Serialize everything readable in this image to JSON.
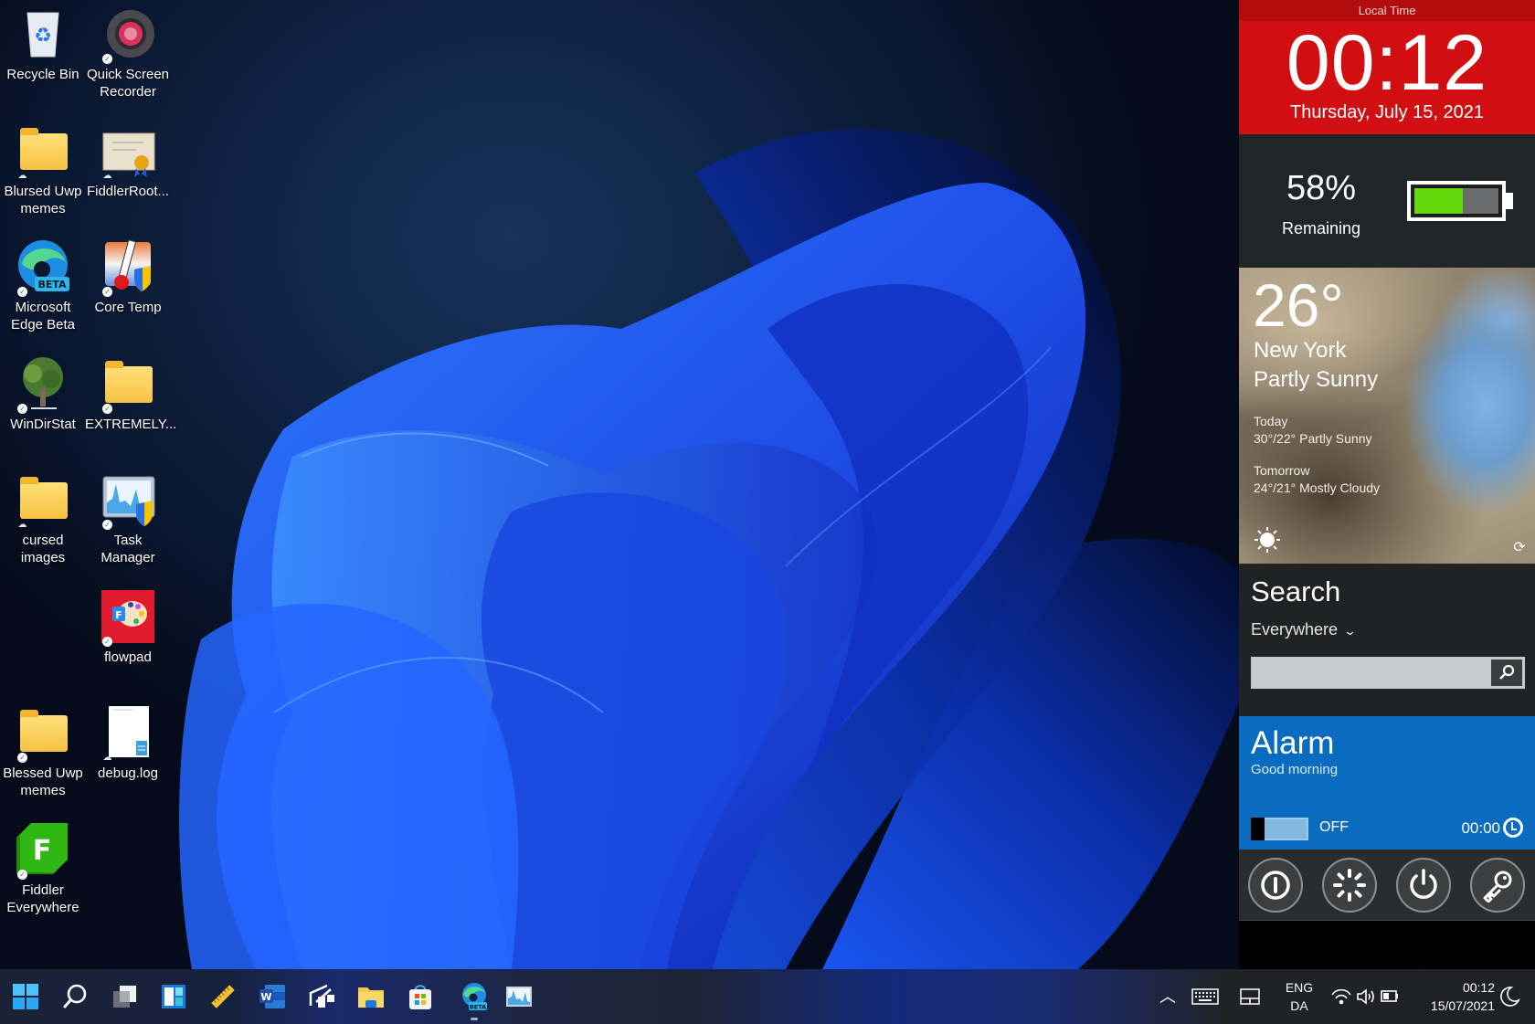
{
  "desktop": {
    "icons": [
      {
        "label": "Recycle Bin",
        "icon": "recycle-bin-icon",
        "status": ""
      },
      {
        "label": "Quick Screen Recorder",
        "icon": "screen-recorder-icon",
        "status": "synced"
      },
      {
        "label": "Blursed Uwp memes",
        "icon": "folder-icon",
        "status": "cloud"
      },
      {
        "label": "FiddlerRoot...",
        "icon": "certificate-icon",
        "status": "cloud"
      },
      {
        "label": "Microsoft Edge Beta",
        "icon": "edge-beta-icon",
        "status": "synced"
      },
      {
        "label": "Core Temp",
        "icon": "thermometer-icon",
        "status": "synced"
      },
      {
        "label": "WinDirStat",
        "icon": "tree-icon",
        "status": "synced"
      },
      {
        "label": "EXTREMELY...",
        "icon": "folder-icon",
        "status": "synced"
      },
      {
        "label": "cursed images",
        "icon": "folder-icon",
        "status": "cloud"
      },
      {
        "label": "Task Manager",
        "icon": "task-manager-icon",
        "status": "synced"
      },
      {
        "label": "flowpad",
        "icon": "flowpad-icon",
        "status": "synced"
      },
      {
        "label": "Blessed Uwp memes",
        "icon": "folder-icon",
        "status": "synced"
      },
      {
        "label": "debug.log",
        "icon": "text-file-icon",
        "status": "cloud"
      },
      {
        "label": "Fiddler Everywhere",
        "icon": "fiddler-icon",
        "status": "synced"
      }
    ]
  },
  "panel": {
    "clock": {
      "header": "Local Time",
      "time": "00:12",
      "date": "Thursday, July 15, 2021",
      "color": "#d10f12"
    },
    "battery": {
      "percent_label": "58%",
      "remaining_label": "Remaining",
      "level": 0.58,
      "fill_color": "#63d90b"
    },
    "weather": {
      "temperature": "26°",
      "city": "New York",
      "condition": "Partly Sunny",
      "forecast": [
        {
          "day": "Today",
          "detail": "30°/22° Partly Sunny"
        },
        {
          "day": "Tomorrow",
          "detail": "24°/21° Mostly Cloudy"
        }
      ]
    },
    "search": {
      "title": "Search",
      "scope": "Everywhere",
      "value": "",
      "placeholder": ""
    },
    "alarm": {
      "title": "Alarm",
      "message": "Good morning",
      "state": "OFF",
      "time": "00:00",
      "color": "#0a6cc0"
    },
    "power_buttons": [
      {
        "name": "shutdown",
        "icon": "shutdown-icon"
      },
      {
        "name": "restart",
        "icon": "restart-icon"
      },
      {
        "name": "power",
        "icon": "power-icon"
      },
      {
        "name": "lock",
        "icon": "key-icon"
      }
    ]
  },
  "taskbar": {
    "apps": [
      {
        "name": "start",
        "icon": "windows-start-icon"
      },
      {
        "name": "search",
        "icon": "search-icon"
      },
      {
        "name": "task-view",
        "icon": "task-view-icon"
      },
      {
        "name": "widgets",
        "icon": "widgets-icon"
      },
      {
        "name": "ruler",
        "icon": "ruler-icon"
      },
      {
        "name": "word",
        "icon": "word-icon"
      },
      {
        "name": "snipping",
        "icon": "snip-icon"
      },
      {
        "name": "file-explorer",
        "icon": "file-explorer-icon"
      },
      {
        "name": "store",
        "icon": "store-icon"
      },
      {
        "name": "edge-beta",
        "icon": "edge-beta-icon",
        "active": true
      },
      {
        "name": "task-manager",
        "icon": "task-manager-icon"
      }
    ],
    "tray": {
      "language_top": "ENG",
      "language_bottom": "DA",
      "time": "00:12",
      "date": "15/07/2021"
    }
  }
}
